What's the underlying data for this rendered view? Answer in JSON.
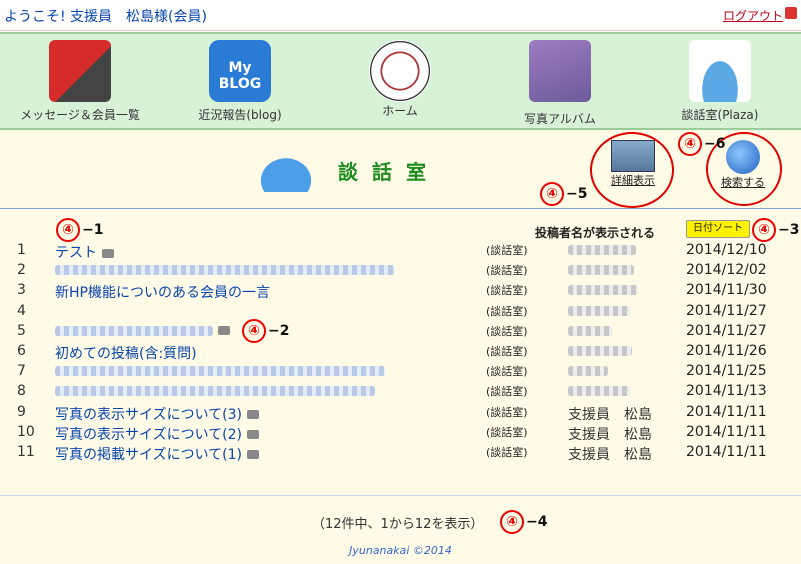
{
  "header": {
    "welcome": "ようこそ! 支援員　松島様(会員)",
    "logout": "ログアウト"
  },
  "nav": [
    {
      "label": "メッセージ＆会員一覧",
      "icon": "message-members-icon"
    },
    {
      "label": "近況報告(blog)",
      "icon": "blog-icon",
      "badge": "My BLOG"
    },
    {
      "label": "ホーム",
      "icon": "compass-home-icon"
    },
    {
      "label": "写真アルバム",
      "icon": "photo-album-icon"
    },
    {
      "label": "談話室(Plaza)",
      "icon": "plaza-icon"
    }
  ],
  "section": {
    "title": "談話室",
    "detail_button": "詳細表示",
    "search_button": "検索する"
  },
  "list": {
    "author_header": "投稿者名が表示される",
    "sort_button": "日付ソート",
    "rows": [
      {
        "no": "1",
        "title": "テスト",
        "cam": true,
        "cat": "(談話室)",
        "author": "",
        "date": "2014/12/10"
      },
      {
        "no": "2",
        "title": "",
        "cam": false,
        "cat": "(談話室)",
        "author": "",
        "date": "2014/12/02"
      },
      {
        "no": "3",
        "title": "新HP機能についのある会員の一言",
        "cam": false,
        "cat": "(談話室)",
        "author": "",
        "date": "2014/11/30"
      },
      {
        "no": "4",
        "title": "",
        "cam": false,
        "cat": "(談話室)",
        "author": "",
        "date": "2014/11/27"
      },
      {
        "no": "5",
        "title": "",
        "cam": true,
        "cat": "(談話室)",
        "author": "",
        "date": "2014/11/27"
      },
      {
        "no": "6",
        "title": "初めての投稿(含:質問)",
        "cam": false,
        "cat": "(談話室)",
        "author": "",
        "date": "2014/11/26"
      },
      {
        "no": "7",
        "title": "",
        "cam": false,
        "cat": "(談話室)",
        "author": "",
        "date": "2014/11/25"
      },
      {
        "no": "8",
        "title": "",
        "cam": false,
        "cat": "(談話室)",
        "author": "",
        "date": "2014/11/13"
      },
      {
        "no": "9",
        "title": "写真の表示サイズについて(3)",
        "cam": true,
        "cat": "(談話室)",
        "author": "支援員　松島",
        "date": "2014/11/11"
      },
      {
        "no": "10",
        "title": "写真の表示サイズについて(2)",
        "cam": true,
        "cat": "(談話室)",
        "author": "支援員　松島",
        "date": "2014/11/11"
      },
      {
        "no": "11",
        "title": "写真の掲載サイズについて(1)",
        "cam": true,
        "cat": "(談話室)",
        "author": "支援員　松島",
        "date": "2014/11/11"
      }
    ]
  },
  "annotations": {
    "a1": "−1",
    "a2": "−2",
    "a3": "−3",
    "a4": "−4",
    "a5": "−5",
    "a6": "−6",
    "circled": "④"
  },
  "footer": {
    "summary": "（12件中、1から12を表示）",
    "copyright": "Jyunanakai ©2014"
  }
}
